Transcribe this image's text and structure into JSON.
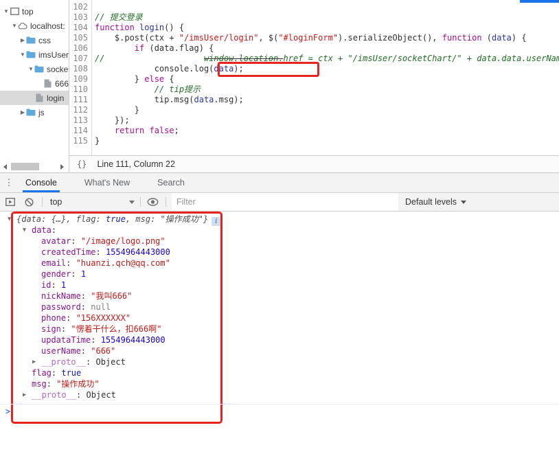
{
  "colors": {
    "accent_blue": "#1a73e8",
    "annotation_red": "#e8231f",
    "folder_blue": "#5fa9dd",
    "comment_green": "#236e25",
    "keyword_magenta": "#aa0d91",
    "string_red": "#c41a16",
    "number_blue": "#1c00cf",
    "property_purple": "#881391"
  },
  "sources": {
    "navigator": {
      "items": [
        {
          "label": "top",
          "icon": "frame-icon",
          "arrow": "▼",
          "indent": 0,
          "selected": false
        },
        {
          "label": "localhost:",
          "icon": "cloud-icon",
          "arrow": "▼",
          "indent": 1,
          "selected": false
        },
        {
          "label": "css",
          "icon": "folder-icon",
          "arrow": "▶",
          "indent": 2,
          "selected": false
        },
        {
          "label": "imsUser",
          "icon": "folder-icon",
          "arrow": "▼",
          "indent": 2,
          "selected": false
        },
        {
          "label": "socket",
          "icon": "folder-icon",
          "arrow": "▼",
          "indent": 3,
          "selected": false
        },
        {
          "label": "666",
          "icon": "file-icon",
          "arrow": "",
          "indent": 4,
          "selected": false
        },
        {
          "label": "login",
          "icon": "file-icon",
          "arrow": "",
          "indent": 3,
          "selected": true
        },
        {
          "label": "js",
          "icon": "folder-icon",
          "arrow": "▶",
          "indent": 2,
          "selected": false
        }
      ]
    },
    "editor": {
      "lines": [
        {
          "no": "102",
          "tokens": []
        },
        {
          "no": "103",
          "tokens": [
            {
              "c": "com",
              "v": "// 提交登录"
            }
          ]
        },
        {
          "no": "104",
          "tokens": [
            {
              "c": "kw",
              "v": "function"
            },
            {
              "c": "pl",
              "v": " "
            },
            {
              "c": "def",
              "v": "login"
            },
            {
              "c": "pl",
              "v": "() {"
            }
          ]
        },
        {
          "no": "105",
          "tokens": [
            {
              "c": "pl",
              "v": "    $.post(ctx + "
            },
            {
              "c": "str",
              "v": "\"/imsUser/login\""
            },
            {
              "c": "pl",
              "v": ", $("
            },
            {
              "c": "str",
              "v": "\"#loginForm\""
            },
            {
              "c": "pl",
              "v": ").serializeObject(), "
            },
            {
              "c": "kw",
              "v": "function"
            },
            {
              "c": "pl",
              "v": " ("
            },
            {
              "c": "def",
              "v": "data"
            },
            {
              "c": "pl",
              "v": ") {"
            }
          ]
        },
        {
          "no": "106",
          "tokens": [
            {
              "c": "pl",
              "v": "        "
            },
            {
              "c": "kw",
              "v": "if"
            },
            {
              "c": "pl",
              "v": " (data.flag) {"
            }
          ]
        },
        {
          "no": "107",
          "tokens": [
            {
              "c": "com",
              "v": "//"
            },
            {
              "c": "pl",
              "v": "                    "
            },
            {
              "c": "comstrike",
              "v": "window.location."
            },
            {
              "c": "com",
              "v": "href = ctx + \"/imsUser/socketChart/\" + data.data.userName + \".html\""
            }
          ]
        },
        {
          "no": "108",
          "tokens": [
            {
              "c": "pl",
              "v": "            console.log("
            },
            {
              "c": "def",
              "v": "data"
            },
            {
              "c": "pl",
              "v": ");"
            }
          ]
        },
        {
          "no": "109",
          "tokens": [
            {
              "c": "pl",
              "v": "        } "
            },
            {
              "c": "kw",
              "v": "else"
            },
            {
              "c": "pl",
              "v": " {"
            }
          ]
        },
        {
          "no": "110",
          "tokens": [
            {
              "c": "pl",
              "v": "            "
            },
            {
              "c": "com",
              "v": "// tip提示"
            }
          ]
        },
        {
          "no": "111",
          "tokens": [
            {
              "c": "pl",
              "v": "            tip.msg("
            },
            {
              "c": "def",
              "v": "data"
            },
            {
              "c": "pl",
              "v": ".msg);"
            }
          ]
        },
        {
          "no": "112",
          "tokens": [
            {
              "c": "pl",
              "v": "        }"
            }
          ]
        },
        {
          "no": "113",
          "tokens": [
            {
              "c": "pl",
              "v": "    });"
            }
          ]
        },
        {
          "no": "114",
          "tokens": [
            {
              "c": "pl",
              "v": "    "
            },
            {
              "c": "kw",
              "v": "return"
            },
            {
              "c": "pl",
              "v": " "
            },
            {
              "c": "kw",
              "v": "false"
            },
            {
              "c": "pl",
              "v": ";"
            }
          ]
        },
        {
          "no": "115",
          "tokens": [
            {
              "c": "pl",
              "v": "}"
            }
          ]
        }
      ]
    },
    "status_bar": {
      "brace_icon": "{}",
      "position": "Line 111, Column 22"
    }
  },
  "console_panel": {
    "kebab_icon": "⋮",
    "tabs": [
      {
        "label": "Console",
        "active": true
      },
      {
        "label": "What's New",
        "active": false
      },
      {
        "label": "Search",
        "active": false
      }
    ],
    "toolbar": {
      "context": "top",
      "filter_placeholder": "Filter",
      "levels_label": "Default levels",
      "icons": [
        "console-sidebar-toggle-icon",
        "clear-console-icon",
        "live-expression-eye-icon"
      ]
    },
    "info_badge": "i",
    "prompt": ">",
    "rows": [
      {
        "arrow": "▼",
        "indent": 0,
        "info": true,
        "tokens": [
          {
            "c": "prev",
            "v": "{data: {…}, flag: "
          },
          {
            "c": "prev bool",
            "v": "true"
          },
          {
            "c": "prev",
            "v": ", msg: "
          },
          {
            "c": "prev str",
            "v": "\"操作成功\""
          },
          {
            "c": "prev",
            "v": "}"
          }
        ]
      },
      {
        "arrow": "▼",
        "indent": 1,
        "tokens": [
          {
            "c": "name",
            "v": "data"
          },
          {
            "c": "pl",
            "v": ":"
          }
        ]
      },
      {
        "arrow": "",
        "indent": 2,
        "tokens": [
          {
            "c": "name",
            "v": "avatar"
          },
          {
            "c": "pl",
            "v": ": "
          },
          {
            "c": "str",
            "v": "\"/image/logo.png\""
          }
        ]
      },
      {
        "arrow": "",
        "indent": 2,
        "tokens": [
          {
            "c": "name",
            "v": "createdTime"
          },
          {
            "c": "pl",
            "v": ": "
          },
          {
            "c": "num",
            "v": "1554964443000"
          }
        ]
      },
      {
        "arrow": "",
        "indent": 2,
        "tokens": [
          {
            "c": "name",
            "v": "email"
          },
          {
            "c": "pl",
            "v": ": "
          },
          {
            "c": "str",
            "v": "\"huanzi.qch@qq.com\""
          }
        ]
      },
      {
        "arrow": "",
        "indent": 2,
        "tokens": [
          {
            "c": "name",
            "v": "gender"
          },
          {
            "c": "pl",
            "v": ": "
          },
          {
            "c": "num",
            "v": "1"
          }
        ]
      },
      {
        "arrow": "",
        "indent": 2,
        "tokens": [
          {
            "c": "name",
            "v": "id"
          },
          {
            "c": "pl",
            "v": ": "
          },
          {
            "c": "num",
            "v": "1"
          }
        ]
      },
      {
        "arrow": "",
        "indent": 2,
        "tokens": [
          {
            "c": "name",
            "v": "nickName"
          },
          {
            "c": "pl",
            "v": ": "
          },
          {
            "c": "str",
            "v": "\"我叫666\""
          }
        ]
      },
      {
        "arrow": "",
        "indent": 2,
        "tokens": [
          {
            "c": "name",
            "v": "password"
          },
          {
            "c": "pl",
            "v": ": "
          },
          {
            "c": "null",
            "v": "null"
          }
        ]
      },
      {
        "arrow": "",
        "indent": 2,
        "tokens": [
          {
            "c": "name",
            "v": "phone"
          },
          {
            "c": "pl",
            "v": ": "
          },
          {
            "c": "str",
            "v": "\"156XXXXXX\""
          }
        ]
      },
      {
        "arrow": "",
        "indent": 2,
        "tokens": [
          {
            "c": "name",
            "v": "sign"
          },
          {
            "c": "pl",
            "v": ": "
          },
          {
            "c": "str",
            "v": "\"愣着干什么，扣666啊\""
          }
        ]
      },
      {
        "arrow": "",
        "indent": 2,
        "tokens": [
          {
            "c": "name",
            "v": "updataTime"
          },
          {
            "c": "pl",
            "v": ": "
          },
          {
            "c": "num",
            "v": "1554964443000"
          }
        ]
      },
      {
        "arrow": "",
        "indent": 2,
        "tokens": [
          {
            "c": "name",
            "v": "userName"
          },
          {
            "c": "pl",
            "v": ": "
          },
          {
            "c": "str",
            "v": "\"666\""
          }
        ]
      },
      {
        "arrow": "▶",
        "indent": 2,
        "tokens": [
          {
            "c": "proto",
            "v": "__proto__"
          },
          {
            "c": "pl",
            "v": ": "
          },
          {
            "c": "pl",
            "v": "Object"
          }
        ]
      },
      {
        "arrow": "",
        "indent": 1,
        "tokens": [
          {
            "c": "name",
            "v": "flag"
          },
          {
            "c": "pl",
            "v": ": "
          },
          {
            "c": "bool",
            "v": "true"
          }
        ]
      },
      {
        "arrow": "",
        "indent": 1,
        "tokens": [
          {
            "c": "name",
            "v": "msg"
          },
          {
            "c": "pl",
            "v": ": "
          },
          {
            "c": "str",
            "v": "\"操作成功\""
          }
        ]
      },
      {
        "arrow": "▶",
        "indent": 1,
        "tokens": [
          {
            "c": "proto",
            "v": "__proto__"
          },
          {
            "c": "pl",
            "v": ": "
          },
          {
            "c": "pl",
            "v": "Object"
          }
        ]
      }
    ]
  }
}
